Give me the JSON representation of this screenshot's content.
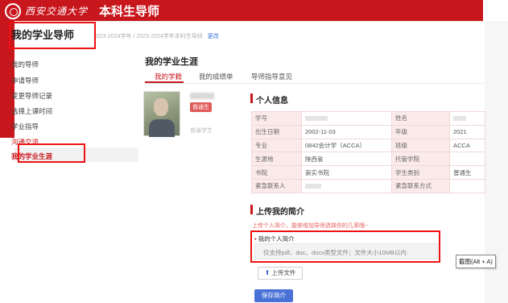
{
  "header": {
    "university_name": "西安交通大学",
    "system_name": "本科生导师"
  },
  "subheader": {
    "page_title": "我的学业导师",
    "breadcrumb": "2023-2024学年 / 2023-2024学年本科生导师",
    "change_link": "更改"
  },
  "sidebar": {
    "items": [
      {
        "label": "我的导师"
      },
      {
        "label": "申请导师"
      },
      {
        "label": "变更导师记录"
      },
      {
        "label": "选择上课时间"
      },
      {
        "label": "学业指导"
      },
      {
        "label": "沟通交流"
      },
      {
        "label": "我的学业生涯"
      }
    ],
    "active_index": 6
  },
  "main": {
    "title": "我的学业生涯",
    "tabs": [
      {
        "label": "我的学籍"
      },
      {
        "label": "我的成绩单"
      },
      {
        "label": "导师指导意见"
      }
    ],
    "active_tab": 0
  },
  "student": {
    "badge": "普通生",
    "sub": "普通学生"
  },
  "personal_info": {
    "section_title": "个人信息",
    "rows": [
      {
        "l1": "学号",
        "v1": "",
        "l2": "姓名",
        "v2": ""
      },
      {
        "l1": "出生日期",
        "v1": "2002-11-03",
        "l2": "年级",
        "v2": "2021"
      },
      {
        "l1": "专业",
        "v1": "0842会计学（ACCA）",
        "l2": "班级",
        "v2": "ACCA"
      },
      {
        "l1": "生源地",
        "v1": "陕西省",
        "l2": "托管学院",
        "v2": ""
      },
      {
        "l1": "书院",
        "v1": "崇实书院",
        "l2": "学生类别",
        "v2": "普通生"
      },
      {
        "l1": "紧急联系人",
        "v1": "",
        "l2": "紧急联系方式",
        "v2": ""
      }
    ]
  },
  "upload": {
    "section_title": "上传我的简介",
    "hint": "上传个人简介，能够增加导师选择你的几率哦~",
    "field_label": "我的个人简介",
    "dropbox_text": "仅支持pdf、doc、docx类型文件；文件大小10MB以内",
    "upload_button": "上传文件",
    "save_button": "保存简介"
  },
  "tooltip": "截图(Alt + A)",
  "colors": {
    "brand_red": "#c8161d",
    "link_blue": "#3a6fd8",
    "save_blue": "#4a72d6",
    "highlight": "#e11111"
  }
}
